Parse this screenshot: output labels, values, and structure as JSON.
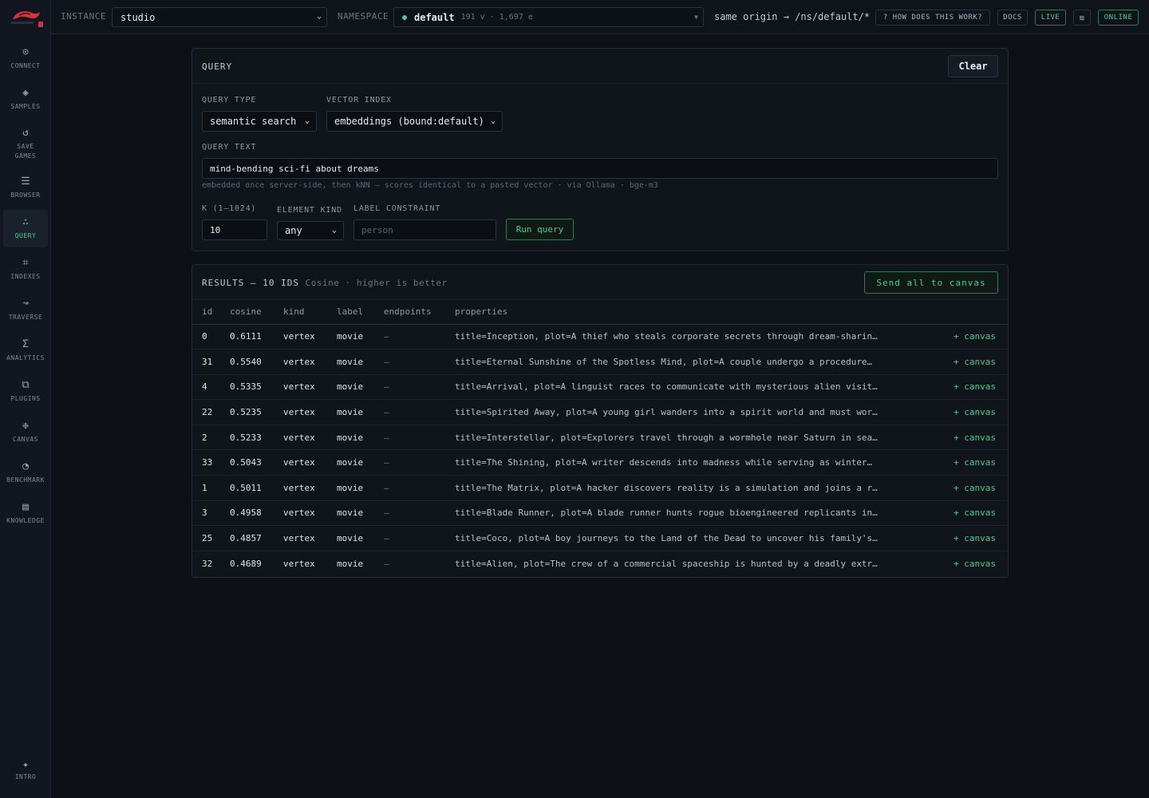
{
  "sidebar": {
    "items": [
      {
        "label": "CONNECT",
        "icon": "⊙",
        "icon_name": "connect-icon"
      },
      {
        "label": "SAMPLES",
        "icon": "◈",
        "icon_name": "samples-icon"
      },
      {
        "label": "SAVE GAMES",
        "icon": "↺",
        "icon_name": "save-games-icon"
      },
      {
        "label": "BROWSER",
        "icon": "☰",
        "icon_name": "browser-icon"
      },
      {
        "label": "QUERY",
        "icon": "∴",
        "icon_name": "query-icon"
      },
      {
        "label": "INDEXES",
        "icon": "⌗",
        "icon_name": "indexes-icon"
      },
      {
        "label": "TRAVERSE",
        "icon": "↝",
        "icon_name": "traverse-icon"
      },
      {
        "label": "ANALYTICS",
        "icon": "Σ",
        "icon_name": "analytics-icon"
      },
      {
        "label": "PLUGINS",
        "icon": "⧉",
        "icon_name": "plugins-icon"
      },
      {
        "label": "CANVAS",
        "icon": "❉",
        "icon_name": "canvas-icon"
      },
      {
        "label": "BENCHMARK",
        "icon": "◔",
        "icon_name": "benchmark-icon"
      },
      {
        "label": "KNOWLEDGE",
        "icon": "▤",
        "icon_name": "knowledge-icon"
      }
    ],
    "active": "QUERY",
    "bottom": {
      "label": "INTRO",
      "icon": "✦"
    }
  },
  "topbar": {
    "instance_label": "INSTANCE",
    "instance_value": "studio",
    "namespace_label": "NAMESPACE",
    "namespace_value": "default",
    "namespace_meta": "191 v · 1,697 e",
    "origin_text": "same origin → /ns/default/*",
    "help_label": "? HOW DOES THIS WORK?",
    "docs_label": "DOCS",
    "live_label": "LIVE",
    "theme_icon": "≋",
    "online_label": "ONLINE"
  },
  "query_panel": {
    "title": "QUERY",
    "clear_label": "Clear",
    "query_type_label": "QUERY TYPE",
    "query_type_value": "semantic search",
    "vector_index_label": "VECTOR INDEX",
    "vector_index_value": "embeddings (bound:default)",
    "query_text_label": "QUERY TEXT",
    "query_text_value": "mind-bending sci-fi about dreams",
    "query_hint": "embedded once server-side, then kNN — scores identical to a pasted vector · via Ollama · bge-m3",
    "k_label": "K (1–1024)",
    "k_value": "10",
    "element_kind_label": "ELEMENT KIND",
    "element_kind_value": "any",
    "label_constraint_label": "LABEL CONSTRAINT",
    "label_constraint_placeholder": "person",
    "run_label": "Run query"
  },
  "results": {
    "title": "RESULTS — 10 IDS",
    "subtitle": "Cosine · higher is better",
    "send_all_label": "Send all to canvas",
    "columns": [
      "id",
      "cosine",
      "kind",
      "label",
      "endpoints",
      "properties"
    ],
    "canvas_action": "+ canvas",
    "rows": [
      {
        "id": "0",
        "cosine": "0.6111",
        "kind": "vertex",
        "label": "movie",
        "endpoints": "—",
        "properties": "title=Inception, plot=A thief who steals corporate secrets through dream-sharin…"
      },
      {
        "id": "31",
        "cosine": "0.5540",
        "kind": "vertex",
        "label": "movie",
        "endpoints": "—",
        "properties": "title=Eternal Sunshine of the Spotless Mind, plot=A couple undergo a procedure…"
      },
      {
        "id": "4",
        "cosine": "0.5335",
        "kind": "vertex",
        "label": "movie",
        "endpoints": "—",
        "properties": "title=Arrival, plot=A linguist races to communicate with mysterious alien visit…"
      },
      {
        "id": "22",
        "cosine": "0.5235",
        "kind": "vertex",
        "label": "movie",
        "endpoints": "—",
        "properties": "title=Spirited Away, plot=A young girl wanders into a spirit world and must wor…"
      },
      {
        "id": "2",
        "cosine": "0.5233",
        "kind": "vertex",
        "label": "movie",
        "endpoints": "—",
        "properties": "title=Interstellar, plot=Explorers travel through a wormhole near Saturn in sea…"
      },
      {
        "id": "33",
        "cosine": "0.5043",
        "kind": "vertex",
        "label": "movie",
        "endpoints": "—",
        "properties": "title=The Shining, plot=A writer descends into madness while serving as winter…"
      },
      {
        "id": "1",
        "cosine": "0.5011",
        "kind": "vertex",
        "label": "movie",
        "endpoints": "—",
        "properties": "title=The Matrix, plot=A hacker discovers reality is a simulation and joins a r…"
      },
      {
        "id": "3",
        "cosine": "0.4958",
        "kind": "vertex",
        "label": "movie",
        "endpoints": "—",
        "properties": "title=Blade Runner, plot=A blade runner hunts rogue bioengineered replicants in…"
      },
      {
        "id": "25",
        "cosine": "0.4857",
        "kind": "vertex",
        "label": "movie",
        "endpoints": "—",
        "properties": "title=Coco, plot=A boy journeys to the Land of the Dead to uncover his family's…"
      },
      {
        "id": "32",
        "cosine": "0.4689",
        "kind": "vertex",
        "label": "movie",
        "endpoints": "—",
        "properties": "title=Alien, plot=The crew of a commercial spaceship is hunted by a deadly extr…"
      }
    ]
  },
  "colors": {
    "accent": "#4ec98a",
    "background": "#0d1017",
    "panel": "#10141b",
    "logo_red": "#d8323c"
  }
}
